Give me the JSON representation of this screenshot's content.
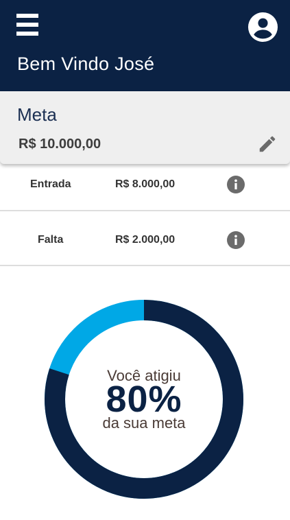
{
  "header": {
    "welcome": "Bem Vindo José"
  },
  "meta": {
    "title": "Meta",
    "value": "R$ 10.000,00"
  },
  "rows": [
    {
      "label": "Entrada",
      "value": "R$ 8.000,00"
    },
    {
      "label": "Falta",
      "value": "R$ 2.000,00"
    }
  ],
  "progress": {
    "line1": "Você atigiu",
    "percent_label": "80%",
    "line2": "da sua meta",
    "fraction": 0.8
  },
  "colors": {
    "primary": "#0b2244",
    "accent": "#00a8e6",
    "icon_gray": "#6b6b6b"
  },
  "icons": {
    "menu": "menu-icon",
    "profile": "account-circle-icon",
    "edit": "pencil-icon",
    "info": "info-icon"
  }
}
